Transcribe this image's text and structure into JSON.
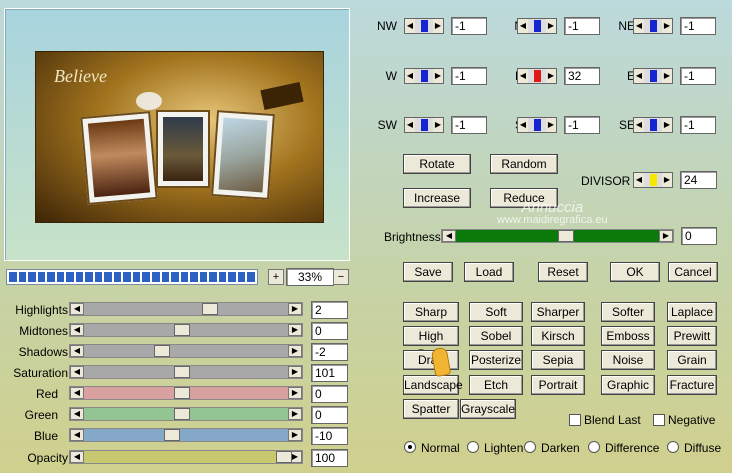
{
  "preview": {
    "zoom_value": "33%",
    "zoom_plus": "+",
    "zoom_minus": "−"
  },
  "adjustments": [
    {
      "label": "Highlights",
      "value": "2",
      "color": "#a8a8a8"
    },
    {
      "label": "Midtones",
      "value": "0",
      "color": "#a8a8a8"
    },
    {
      "label": "Shadows",
      "value": "-2",
      "color": "#a8a8a8"
    },
    {
      "label": "Saturation",
      "value": "101",
      "color": "#a8a8a8"
    },
    {
      "label": "Red",
      "value": "0",
      "color": "#d9a0a0"
    },
    {
      "label": "Green",
      "value": "0",
      "color": "#93c593"
    },
    {
      "label": "Blue",
      "value": "-10",
      "color": "#86a8c8"
    },
    {
      "label": "Opacity",
      "value": "100",
      "color": "#c8c870"
    }
  ],
  "matrix": [
    {
      "label": "NW",
      "value": "-1"
    },
    {
      "label": "N",
      "value": "-1"
    },
    {
      "label": "NE",
      "value": "-1"
    },
    {
      "label": "W",
      "value": "-1"
    },
    {
      "label": "K",
      "value": "32"
    },
    {
      "label": "E",
      "value": "-1"
    },
    {
      "label": "SW",
      "value": "-1"
    },
    {
      "label": "S",
      "value": "-1"
    },
    {
      "label": "SE",
      "value": "-1"
    }
  ],
  "buttons": {
    "rotate": "Rotate",
    "random": "Random",
    "increase": "Increase",
    "reduce": "Reduce",
    "save": "Save",
    "load": "Load",
    "reset": "Reset",
    "ok": "OK",
    "cancel": "Cancel"
  },
  "divisor": {
    "label": "DIVISOR",
    "value": "24"
  },
  "brightness": {
    "label": "Brightness",
    "value": "0"
  },
  "presets": [
    [
      "Sharp",
      "Soft",
      "Sharper",
      "Softer",
      "Laplace"
    ],
    [
      "High Pass",
      "Sobel",
      "Kirsch",
      "Emboss",
      "Prewitt"
    ],
    [
      "Drag",
      "Posterize",
      "Sepia",
      "Noise",
      "Grain"
    ],
    [
      "Landscape",
      "Etch",
      "Portrait",
      "Graphic",
      "Fracture"
    ],
    [
      "Spatter",
      "Grayscale"
    ]
  ],
  "options": {
    "blend_last": "Blend Last",
    "negative": "Negative"
  },
  "blend_modes": [
    "Normal",
    "Lighten",
    "Darken",
    "Difference",
    "Diffuse"
  ],
  "watermark": {
    "line1": "Annuccia",
    "line2": "www.maidiregrafica.eu"
  },
  "image_text": {
    "title": "Believe"
  }
}
